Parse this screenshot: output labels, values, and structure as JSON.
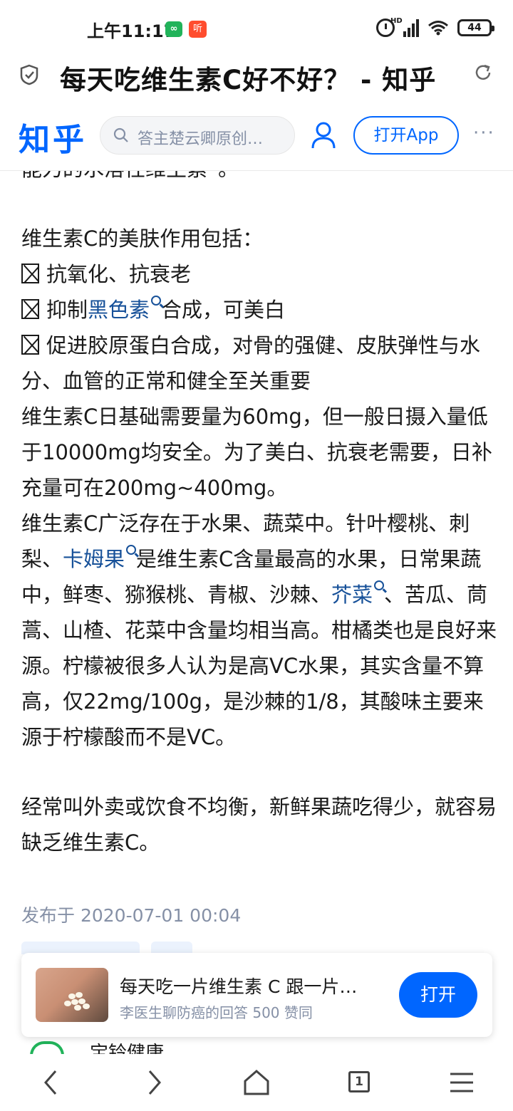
{
  "status_bar": {
    "time": "上午11:17",
    "battery": "44",
    "network": "HD",
    "app_icon_1": "∞",
    "app_icon_2": "听"
  },
  "browser": {
    "page_title": "每天吃维生素C好不好？ - 知乎",
    "icons": [
      "shield-check-icon",
      "reload-icon"
    ]
  },
  "zhihu_header": {
    "logo": "知乎",
    "search_placeholder": "答主楚云卿原创…",
    "open_app_label": "打开App",
    "more": "···"
  },
  "article": {
    "top_partial_line": "能力的水溶性维生素”。",
    "beauty_intro": "维生素C的美肤作用包括：",
    "benefit_1": "抗氧化、抗衰老",
    "benefit_2_pre": "抑制",
    "benefit_2_link": "黑色素",
    "benefit_2_post": "合成，可美白",
    "benefit_3": "促进胶原蛋白合成，对骨的强健、皮肤弹性与水分、血管的正常和健全至关重要",
    "dosage": "维生素C日基础需要量为60mg，但一般日摄入量低于10000mg均安全。为了美白、抗衰老需要，日补充量可在200mg~400mg。",
    "sources_1": "维生素C广泛存在于水果、蔬菜中。针叶樱桃、刺梨、",
    "sources_link_1": "卡姆果",
    "sources_2": "是维生素C含量最高的水果，日常果蔬中，鲜枣、猕猴桃、青椒、沙棘、",
    "sources_link_2": "芥菜",
    "sources_3": "、苦瓜、茼蒿、山楂、花菜中含量均相当高。柑橘类也是良好来源。柠檬被很多人认为是高VC水果，其实含量不算高，仅22mg/100g，是沙棘的1/8，其酸味主要来源于柠檬酸而不是VC。",
    "deficiency": "经常叫外卖或饮食不均衡，新鲜果蔬吃得少，就容易缺乏维生素C。",
    "published": "发布于 2020-07-01 00:04"
  },
  "promo_card": {
    "title": "每天吃一片维生素 C 跟一片…",
    "subtitle": "李医生聊防癌的回答 500 赞同",
    "button": "打开"
  },
  "peek": {
    "text": "宝铃健康"
  },
  "bottom_nav": {
    "tab_count": "1",
    "icons": [
      "back-icon",
      "forward-icon",
      "home-icon",
      "tabs-icon",
      "menu-icon"
    ]
  },
  "colors": {
    "brand": "#0066ff",
    "link": "#175199",
    "muted": "#8590a6"
  }
}
